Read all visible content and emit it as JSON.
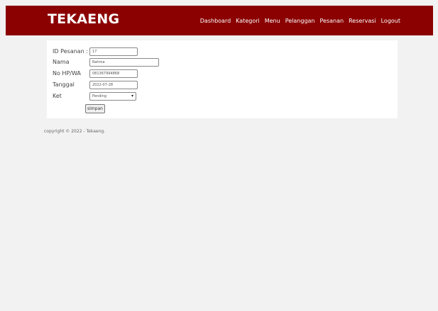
{
  "app": {
    "brand": "TEKAENG"
  },
  "nav": {
    "items": [
      {
        "label": "Dashboard"
      },
      {
        "label": "Kategori"
      },
      {
        "label": "Menu"
      },
      {
        "label": "Pelanggan"
      },
      {
        "label": "Pesanan"
      },
      {
        "label": "Reservasi"
      },
      {
        "label": "Logout"
      }
    ]
  },
  "form": {
    "id_pesanan": {
      "label": "ID Pesanan :",
      "value": "17"
    },
    "nama": {
      "label": "Nama",
      "value": "Rahma"
    },
    "no_hp": {
      "label": "No HP/WA",
      "value": "081367994868"
    },
    "tanggal": {
      "label": "Tanggal",
      "value": "2022-07-28"
    },
    "ket": {
      "label": "Ket",
      "value": "Pending"
    },
    "submit_label": "simpan"
  },
  "footer": {
    "text": "copyright © 2022 - Tekaeng."
  },
  "colors": {
    "navbar": "#8b0000",
    "background": "#f2f2f2",
    "card": "#ffffff"
  }
}
